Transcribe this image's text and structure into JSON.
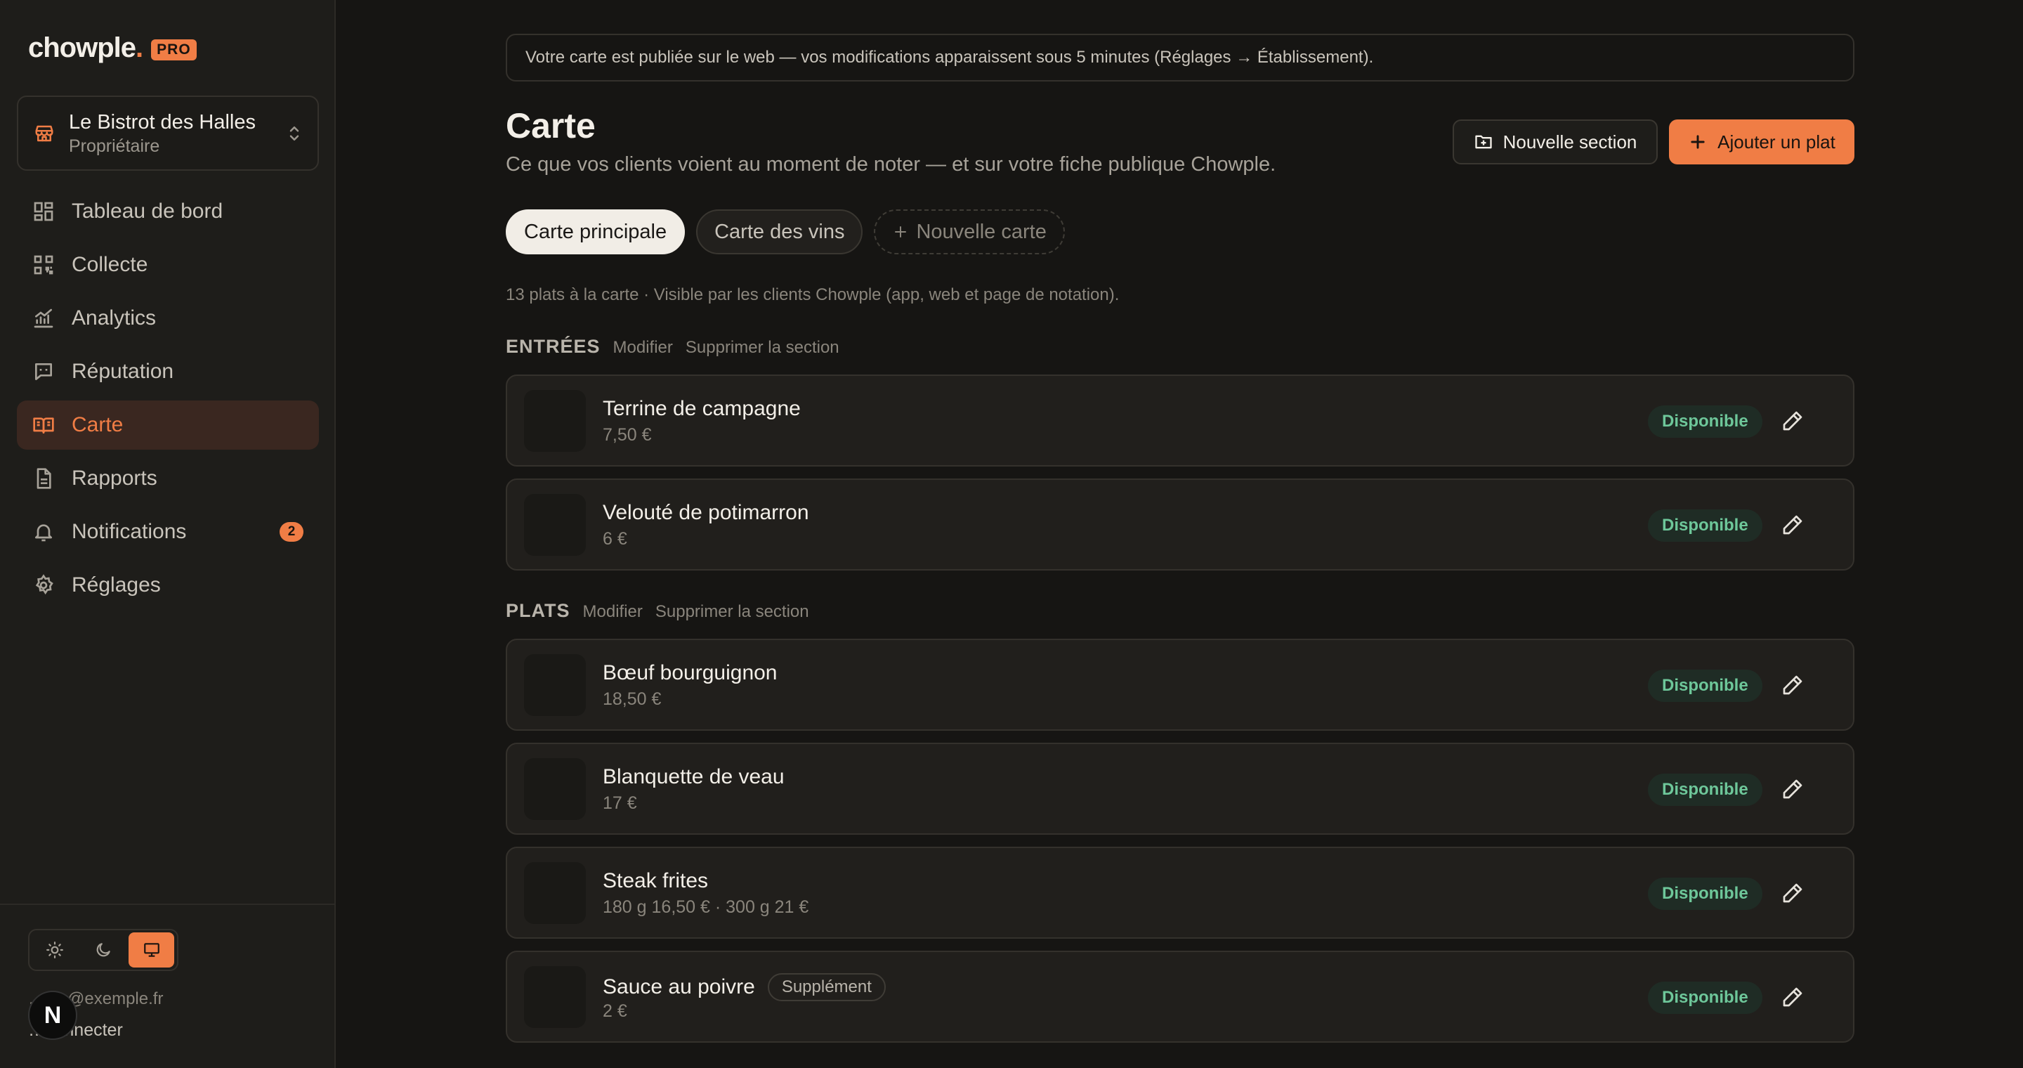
{
  "brand": {
    "name": "chowple",
    "dot": ".",
    "badge": "PRO"
  },
  "venue": {
    "name": "Le Bistrot des Halles",
    "role": "Propriétaire"
  },
  "nav": [
    {
      "label": "Tableau de bord",
      "icon": "dashboard-icon"
    },
    {
      "label": "Collecte",
      "icon": "qr-code-icon"
    },
    {
      "label": "Analytics",
      "icon": "chart-icon"
    },
    {
      "label": "Réputation",
      "icon": "message-icon"
    },
    {
      "label": "Carte",
      "icon": "book-icon",
      "active": true
    },
    {
      "label": "Rapports",
      "icon": "document-icon"
    },
    {
      "label": "Notifications",
      "icon": "bell-icon",
      "badge": "2"
    },
    {
      "label": "Réglages",
      "icon": "gear-icon"
    }
  ],
  "user": {
    "email": "…ion@exemple.fr",
    "logout": "…connecter",
    "avatar_letter": "N"
  },
  "banner": "Votre carte est publiée sur le web — vos modifications apparaissent sous 5 minutes (Réglages → Établissement).",
  "page": {
    "title": "Carte",
    "subtitle": "Ce que vos clients voient au moment de noter — et sur votre fiche publique Chowple.",
    "new_section_label": "Nouvelle section",
    "add_dish_label": "Ajouter un plat"
  },
  "tabs": {
    "main": "Carte principale",
    "wines": "Carte des vins",
    "new": "Nouvelle carte"
  },
  "count_line": "13 plats à la carte · Visible par les clients Chowple (app, web et page de notation).",
  "section_actions": {
    "edit": "Modifier",
    "delete": "Supprimer la section"
  },
  "sections": [
    {
      "title": "ENTRÉES",
      "dishes": [
        {
          "name": "Terrine de campagne",
          "price": "7,50 €",
          "status": "Disponible"
        },
        {
          "name": "Velouté de potimarron",
          "price": "6 €",
          "status": "Disponible"
        }
      ]
    },
    {
      "title": "PLATS",
      "dishes": [
        {
          "name": "Bœuf bourguignon",
          "price": "18,50 €",
          "status": "Disponible"
        },
        {
          "name": "Blanquette de veau",
          "price": "17 €",
          "status": "Disponible"
        },
        {
          "name": "Steak frites",
          "price": "180 g 16,50 € · 300 g 21 €",
          "status": "Disponible"
        },
        {
          "name": "Sauce au poivre",
          "tag": "Supplément",
          "price": "2 €",
          "status": "Disponible"
        }
      ]
    }
  ],
  "colors": {
    "accent": "#f07d45",
    "available_text": "#6ec79a",
    "available_bg": "#1f2c25",
    "background": "#161513"
  }
}
